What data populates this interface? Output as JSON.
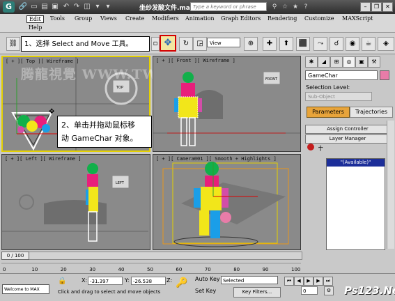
{
  "window": {
    "title": "坐纱发酸文件.max",
    "search_placeholder": "Type a keyword or phrase"
  },
  "menu": [
    "Edit",
    "Tools",
    "Group",
    "Views",
    "Create",
    "Modifiers",
    "Animation",
    "Graph Editors",
    "Rendering",
    "Customize",
    "MAXScript",
    "Help"
  ],
  "toolbar": {
    "view_dropdown": "View"
  },
  "callouts": {
    "step1": "1、选择 Select and Move 工具。",
    "step2_line1": "2、单击并拖动鼠标移",
    "step2_line2": "动 GameChar 对象。"
  },
  "watermark": "腾龍視覺 WWW.TWVI.NET",
  "viewports": {
    "top": "[ + ][ Top ][ Wireframe ]",
    "front": "[ + ][ Front ][ Wireframe ]",
    "left": "[ + ][ Left ][ Wireframe ]",
    "camera": "[ + ][ Camera001 ][ Smooth + Highlights ]",
    "top_cube": "TOP",
    "front_cube": "FRONT",
    "left_cube": "LEFT"
  },
  "command_panel": {
    "object_name": "GameChar",
    "selection_level_label": "Selection Level:",
    "sub_object": "Sub-Object",
    "tab_parameters": "Parameters",
    "tab_trajectories": "Trajectories",
    "rollout_assign": "Assign Controller",
    "rollout_layer": "Layer Manager",
    "layer_available": "\"(Available)\""
  },
  "timeline": {
    "frame_display": "0 / 100",
    "ticks": [
      "0",
      "10",
      "20",
      "30",
      "40",
      "50",
      "60",
      "70",
      "80",
      "90",
      "100"
    ]
  },
  "status": {
    "maxscript": "Welcome to MAX",
    "x_label": "X:",
    "x_value": "-31.397",
    "y_label": "Y:",
    "y_value": "-26.538",
    "z_label": "Z:",
    "prompt": "Click and drag to select and move objects",
    "auto_key": "Auto Key",
    "set_key": "Set Key",
    "selected": "Selected",
    "key_filters": "Key Filters...",
    "current_frame": "0"
  },
  "brand": "Ps123.Net",
  "colors": {
    "active_viewport": "#e4d000",
    "highlight_red": "#d40000",
    "parameters_orange": "#e8a43a",
    "list_selection": "#1c2e99"
  }
}
